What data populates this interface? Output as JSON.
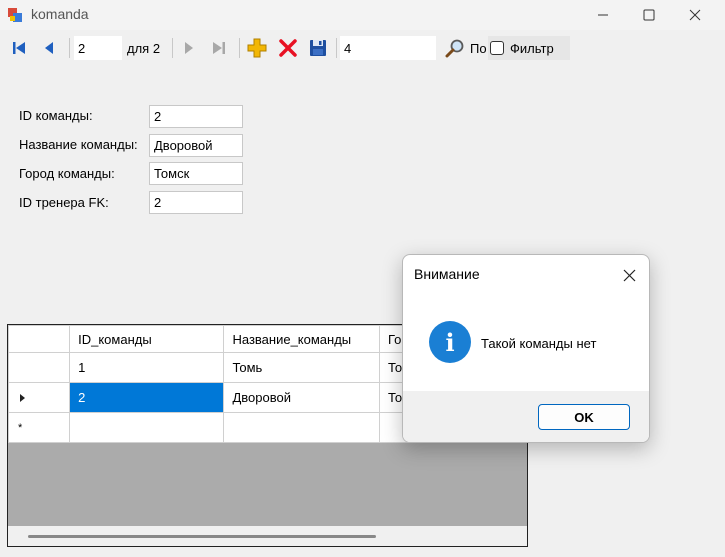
{
  "window": {
    "title": "komanda"
  },
  "toolbar": {
    "position_value": "2",
    "count_label": "для 2",
    "search_value": "4",
    "search_label": "По",
    "filter_label": "Фильтр"
  },
  "form": {
    "fields": [
      {
        "label": "ID команды:",
        "value": "2"
      },
      {
        "label": "Название команды:",
        "value": "Дворовой"
      },
      {
        "label": "Город команды:",
        "value": "Томск"
      },
      {
        "label": "ID тренера FK:",
        "value": "2"
      }
    ]
  },
  "grid": {
    "columns": [
      "ID_команды",
      "Название_команды",
      "Го"
    ],
    "rows": [
      [
        "1",
        "Томь",
        "То"
      ],
      [
        "2",
        "Дворовой",
        "То"
      ]
    ],
    "new_row_marker": "*"
  },
  "dialog": {
    "title": "Внимание",
    "message": "Такой команды нет",
    "ok_label": "OK"
  },
  "colors": {
    "accent": "#0078d7",
    "info_icon": "#1a7fd4",
    "add_icon": "#f2b705",
    "delete_icon": "#e81123",
    "save_icon": "#1e4fa0",
    "nav_icon": "#1f5fbf"
  }
}
